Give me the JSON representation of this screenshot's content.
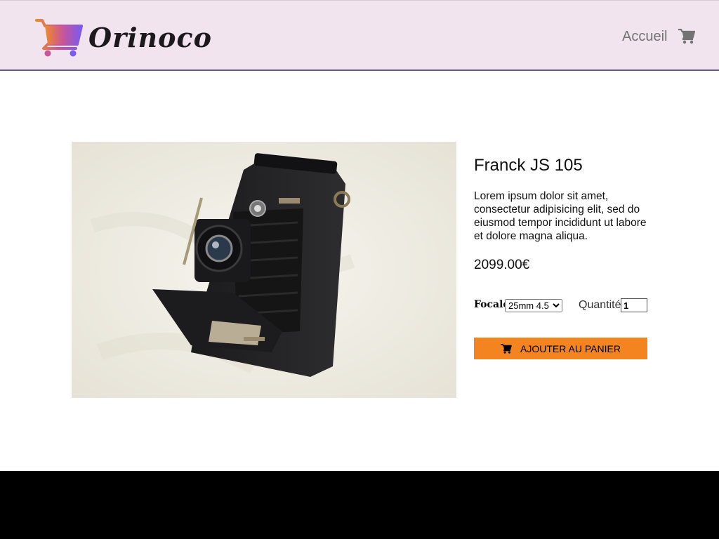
{
  "header": {
    "brand": "Orinoco",
    "nav_home": "Accueil",
    "cart_icon": "shopping-cart-icon"
  },
  "product": {
    "name": "Franck JS 105",
    "description": "Lorem ipsum dolor sit amet, consectetur adipisicing elit, sed do eiusmod tempor incididunt ut labore et dolore magna aliqua.",
    "price": "2099.00€",
    "image_alt": "Vintage folding camera"
  },
  "options": {
    "focale_label": "Focale",
    "focale_selected": "25mm 4.5",
    "quantity_label": "Quantité",
    "quantity_value": "1"
  },
  "actions": {
    "add_to_cart_label": "AJOUTER AU PANIER"
  },
  "colors": {
    "header_bg": "#f1e4ee",
    "button_bg": "#f3841f",
    "footer_bg": "#000000"
  }
}
